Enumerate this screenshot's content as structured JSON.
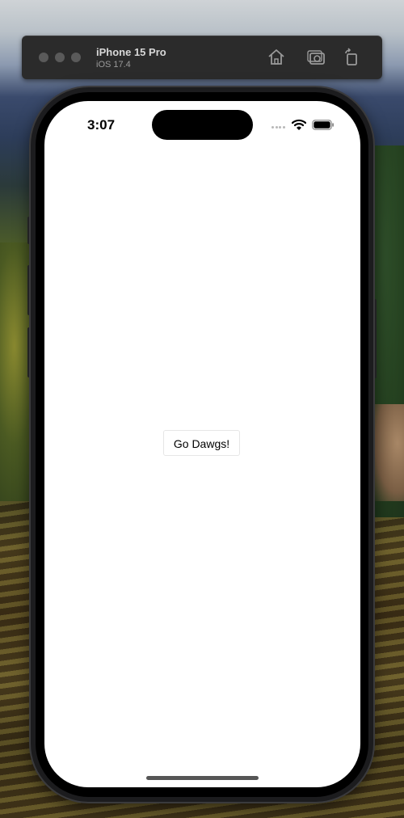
{
  "simulator": {
    "device_name": "iPhone 15 Pro",
    "os_version": "iOS 17.4",
    "toolbar_icons": [
      "home-icon",
      "screenshot-icon",
      "rotate-icon"
    ]
  },
  "status_bar": {
    "time": "3:07",
    "icons": [
      "cellular-signal-icon",
      "wifi-icon",
      "battery-icon"
    ]
  },
  "app": {
    "button_label": "Go Dawgs!"
  },
  "colors": {
    "screen_background": "#ffffff",
    "toolbar_background": "#2b2b2b",
    "dynamic_island": "#000000"
  }
}
